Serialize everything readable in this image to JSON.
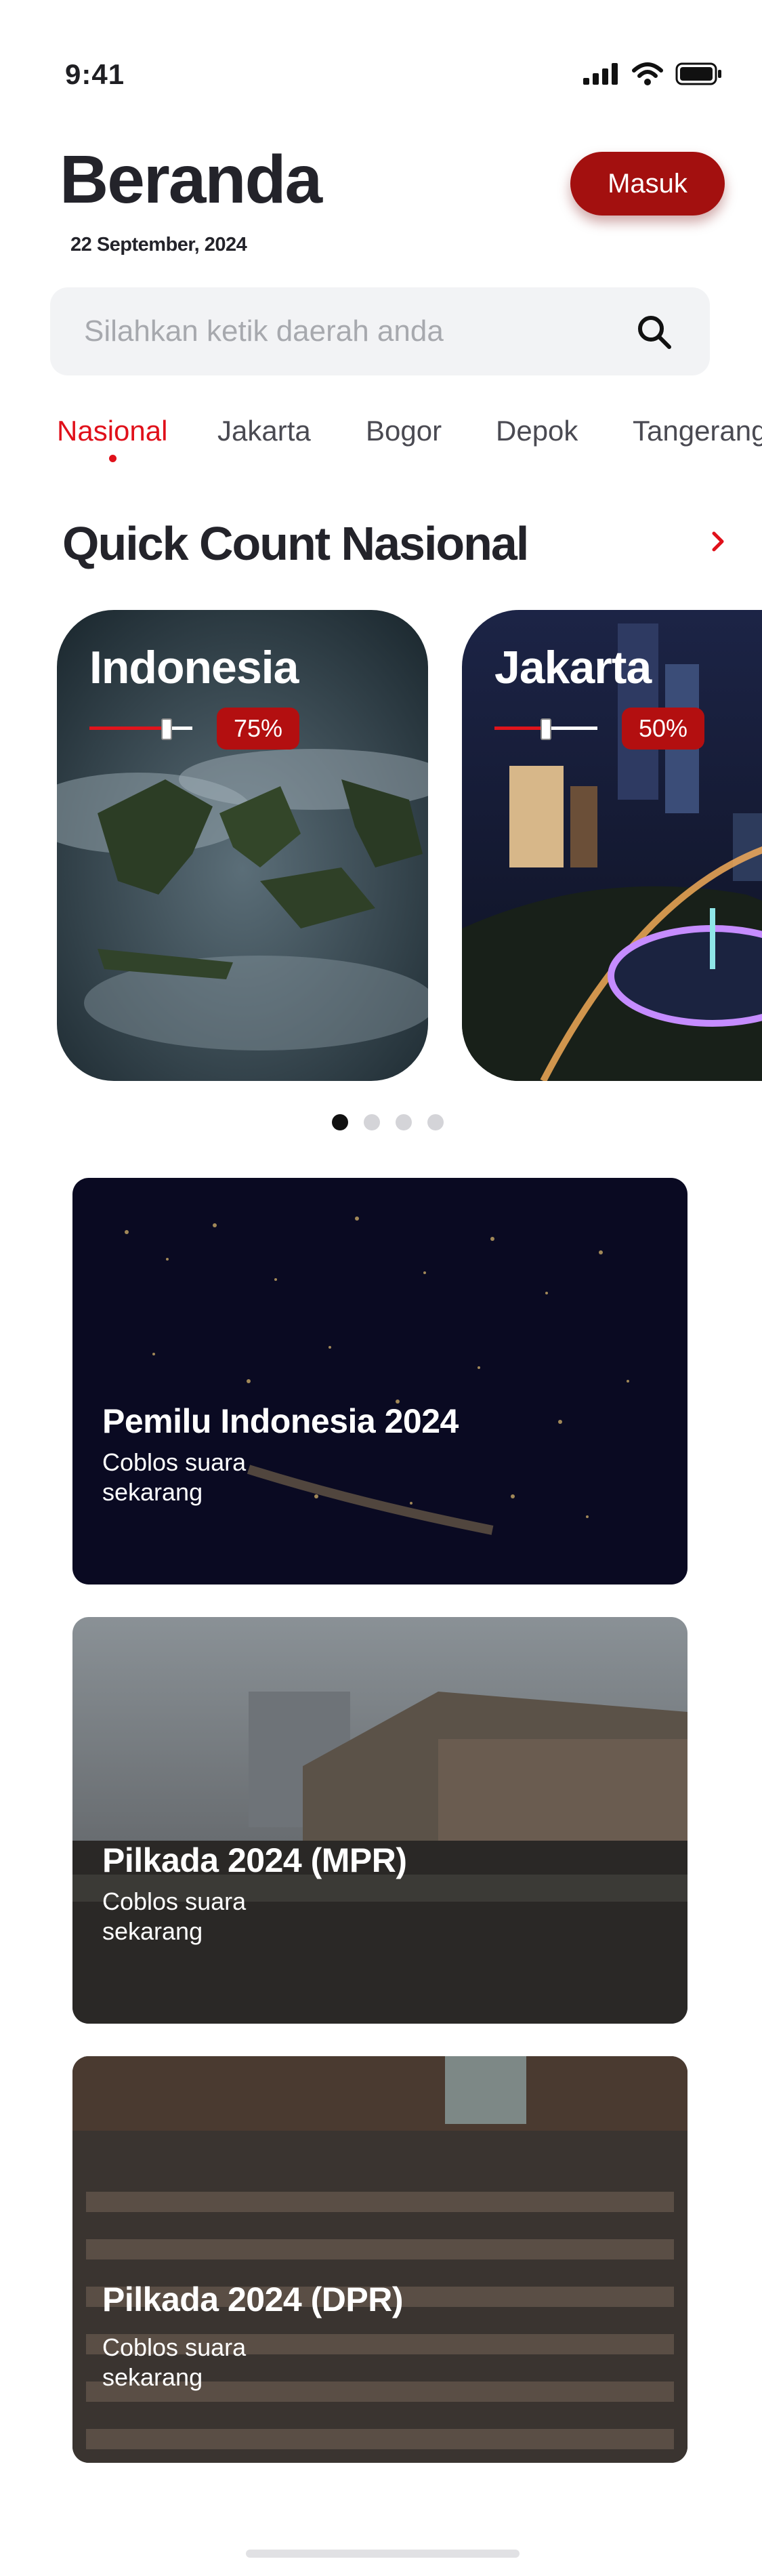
{
  "status_bar": {
    "time": "9:41"
  },
  "header": {
    "title": "Beranda",
    "date": "22 September, 2024",
    "login_label": "Masuk"
  },
  "search": {
    "placeholder": "Silahkan ketik daerah anda"
  },
  "tabs": [
    {
      "label": "Nasional",
      "active": true
    },
    {
      "label": "Jakarta",
      "active": false
    },
    {
      "label": "Bogor",
      "active": false
    },
    {
      "label": "Depok",
      "active": false
    },
    {
      "label": "Tangerang",
      "active": false
    }
  ],
  "quick_count": {
    "title": "Quick Count Nasional",
    "cards": [
      {
        "name": "Indonesia",
        "percent_label": "75%",
        "progress": 0.75
      },
      {
        "name": "Jakarta",
        "percent_label": "50%",
        "progress": 0.5
      }
    ],
    "pagination": {
      "total": 4,
      "active": 0
    }
  },
  "banners": [
    {
      "title": "Pemilu Indonesia 2024",
      "subtitle": "Coblos suara sekarang"
    },
    {
      "title": "Pilkada 2024 (MPR)",
      "subtitle": "Coblos suara sekarang"
    },
    {
      "title": "Pilkada 2024 (DPR)",
      "subtitle": "Coblos suara sekarang"
    }
  ],
  "colors": {
    "accent": "#e0101a",
    "button": "#a3100f",
    "badge": "#b30f10"
  }
}
